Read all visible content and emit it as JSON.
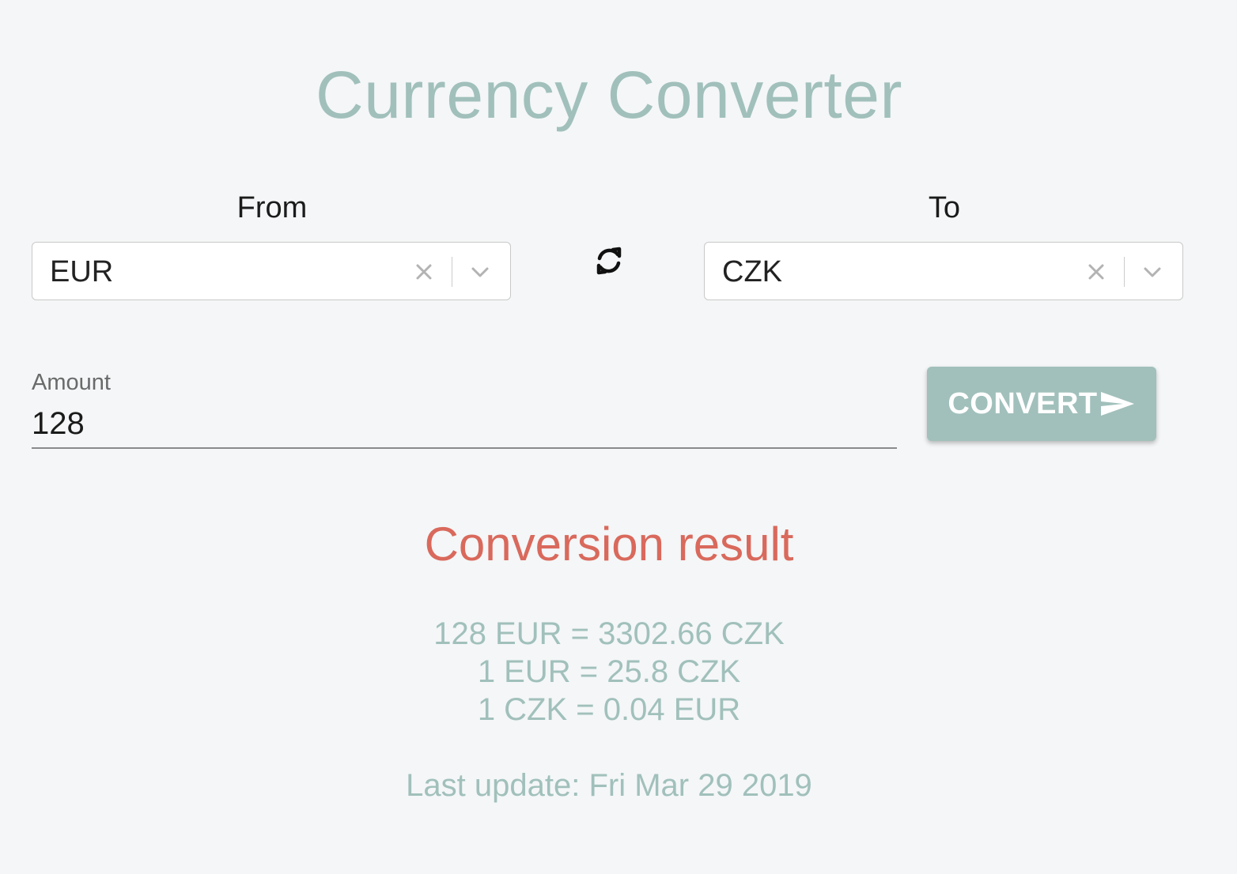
{
  "header": {
    "title": "Currency Converter"
  },
  "from": {
    "label": "From",
    "selected": "EUR"
  },
  "to": {
    "label": "To",
    "selected": "CZK"
  },
  "amount": {
    "label": "Amount",
    "value": "128"
  },
  "convert_button": {
    "label": "CONVERT",
    "icon": "send-arrow-icon"
  },
  "result": {
    "title": "Conversion result",
    "lines": [
      "128 EUR = 3302.66 CZK",
      "1 EUR = 25.8 CZK",
      "1 CZK = 0.04 EUR"
    ],
    "last_update": "Last update: Fri Mar 29 2019"
  },
  "icons": {
    "swap": "swap-icon",
    "clear": "clear-icon",
    "dropdown": "chevron-down-icon"
  },
  "colors": {
    "accent": "#a1c0bb",
    "result_title": "#d9695c",
    "background": "#f4f6f7"
  }
}
